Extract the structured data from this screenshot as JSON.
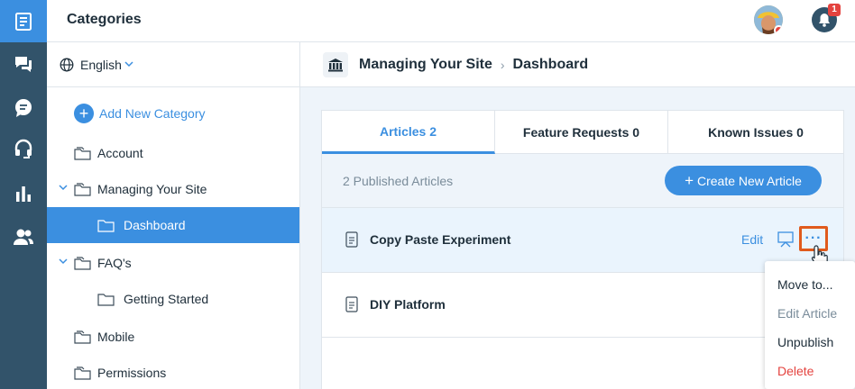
{
  "app": {
    "title": "Categories"
  },
  "rail": {
    "icons": [
      "knowledge-base-icon",
      "chat-icon",
      "message-icon",
      "headset-icon",
      "reports-icon",
      "users-icon"
    ]
  },
  "header": {
    "notification_count": "1"
  },
  "language": {
    "label": "English"
  },
  "sidebar": {
    "add_label": "Add New Category",
    "items": [
      {
        "label": "Account"
      },
      {
        "label": "Managing Your Site"
      },
      {
        "label": "Dashboard"
      },
      {
        "label": "FAQ's"
      },
      {
        "label": "Getting Started"
      },
      {
        "label": "Mobile"
      },
      {
        "label": "Permissions"
      }
    ]
  },
  "breadcrumb": {
    "parent": "Managing Your Site",
    "separator": "›",
    "current": "Dashboard"
  },
  "tabs": [
    {
      "label": "Articles 2"
    },
    {
      "label": "Feature Requests 0"
    },
    {
      "label": "Known Issues 0"
    }
  ],
  "list": {
    "count_label": "2 Published Articles",
    "create_label": "Create New Article",
    "rows": [
      {
        "title": "Copy Paste Experiment",
        "edit_label": "Edit",
        "more_label": "···"
      },
      {
        "title": "DIY Platform"
      }
    ]
  },
  "menu": {
    "items": [
      {
        "label": "Move to..."
      },
      {
        "label": "Edit Article"
      },
      {
        "label": "Unpublish"
      },
      {
        "label": "Delete"
      }
    ]
  },
  "colors": {
    "accent": "#3b8fe0",
    "rail": "#32536a",
    "danger": "#e4433f",
    "highlight": "#e05a1c"
  }
}
